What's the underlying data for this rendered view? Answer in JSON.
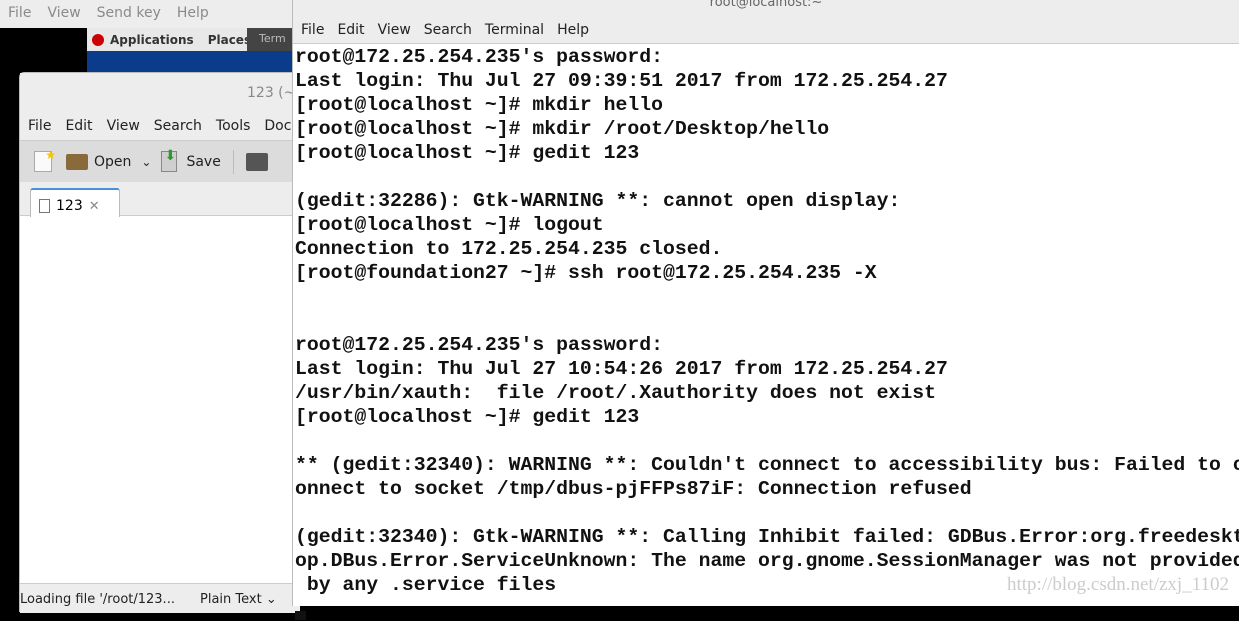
{
  "vm_menu": [
    "File",
    "View",
    "Send key",
    "Help"
  ],
  "panel": {
    "applications": "Applications",
    "places": "Places",
    "terminal_task": "Term"
  },
  "gedit": {
    "title": "123 (~",
    "menu": [
      "File",
      "Edit",
      "View",
      "Search",
      "Tools",
      "Doc"
    ],
    "toolbar": {
      "open": "Open",
      "save": "Save"
    },
    "tab": "123",
    "status": "Loading file '/root/123...",
    "language": "Plain Text"
  },
  "terminal": {
    "title": "root@localhost:~",
    "menu": [
      "File",
      "Edit",
      "View",
      "Search",
      "Terminal",
      "Help"
    ],
    "lines": [
      "root@172.25.254.235's password:",
      "Last login: Thu Jul 27 09:39:51 2017 from 172.25.254.27",
      "[root@localhost ~]# mkdir hello",
      "[root@localhost ~]# mkdir /root/Desktop/hello",
      "[root@localhost ~]# gedit 123",
      "",
      "(gedit:32286): Gtk-WARNING **: cannot open display:",
      "[root@localhost ~]# logout",
      "Connection to 172.25.254.235 closed.",
      "[root@foundation27 ~]# ssh root@172.25.254.235 -X",
      "",
      "",
      "root@172.25.254.235's password:",
      "Last login: Thu Jul 27 10:54:26 2017 from 172.25.254.27",
      "/usr/bin/xauth:  file /root/.Xauthority does not exist",
      "[root@localhost ~]# gedit 123",
      "",
      "** (gedit:32340): WARNING **: Couldn't connect to accessibility bus: Failed to c",
      "onnect to socket /tmp/dbus-pjFFPs87iF: Connection refused",
      "",
      "(gedit:32340): Gtk-WARNING **: Calling Inhibit failed: GDBus.Error:org.freedeskt",
      "op.DBus.Error.ServiceUnknown: The name org.gnome.SessionManager was not provided",
      " by any .service files"
    ]
  },
  "watermark": "http://blog.csdn.net/zxj_1102"
}
